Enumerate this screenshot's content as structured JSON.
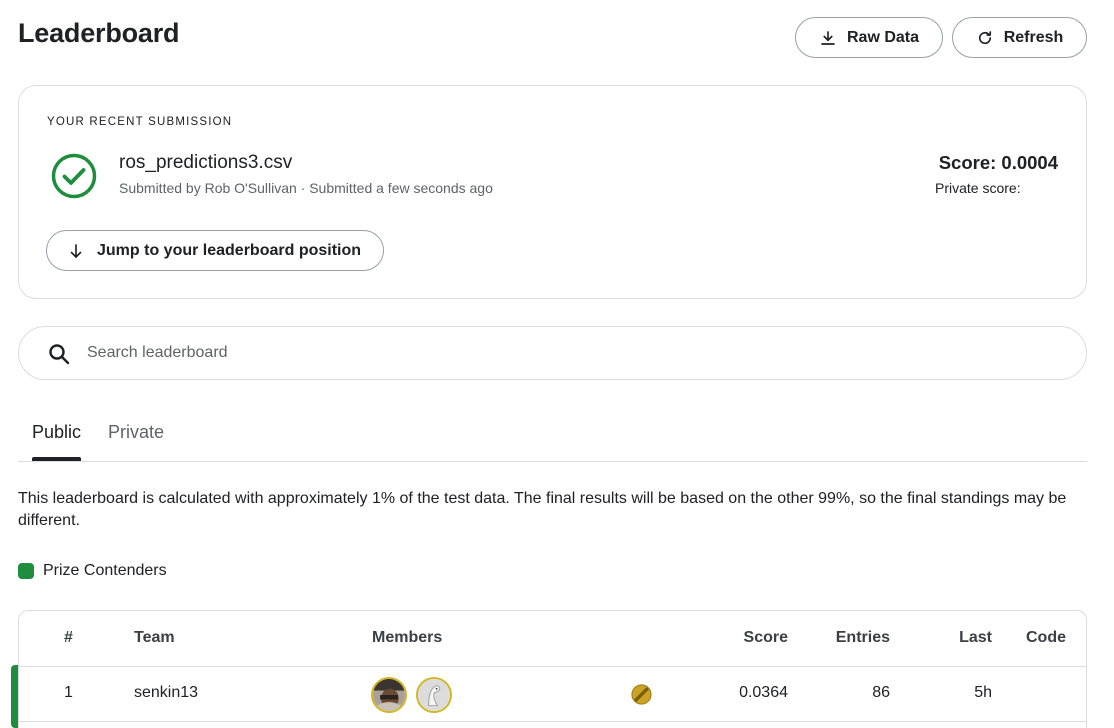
{
  "header": {
    "title": "Leaderboard",
    "raw_data_label": "Raw Data",
    "refresh_label": "Refresh"
  },
  "submission": {
    "eyebrow": "YOUR RECENT SUBMISSION",
    "file_name": "ros_predictions3.csv",
    "meta": "Submitted by Rob O'Sullivan · Submitted a few seconds ago",
    "score": "Score: 0.0004",
    "private_score": "Private score:",
    "jump_label": "Jump to your leaderboard position",
    "status_icon": "check-circle-icon",
    "status_color": "#1e8e3e"
  },
  "search": {
    "placeholder": "Search leaderboard",
    "value": ""
  },
  "tabs": [
    {
      "label": "Public",
      "active": true
    },
    {
      "label": "Private",
      "active": false
    }
  ],
  "notice": "This leaderboard is calculated with approximately 1% of the test data. The final results will be based on the other 99%, so the final standings may be different.",
  "legend": {
    "label": "Prize Contenders",
    "color": "#1e8e3e"
  },
  "table": {
    "columns": [
      "#",
      "Team",
      "Members",
      "Score",
      "Entries",
      "Last",
      "Code"
    ],
    "rows": [
      {
        "rank": "1",
        "team": "senkin13",
        "members": [
          "member-avatar-1",
          "member-avatar-2"
        ],
        "medal": "gold-medal-icon",
        "score": "0.0364",
        "entries": "86",
        "last": "5h",
        "code": "",
        "prize_contender": true
      }
    ]
  }
}
